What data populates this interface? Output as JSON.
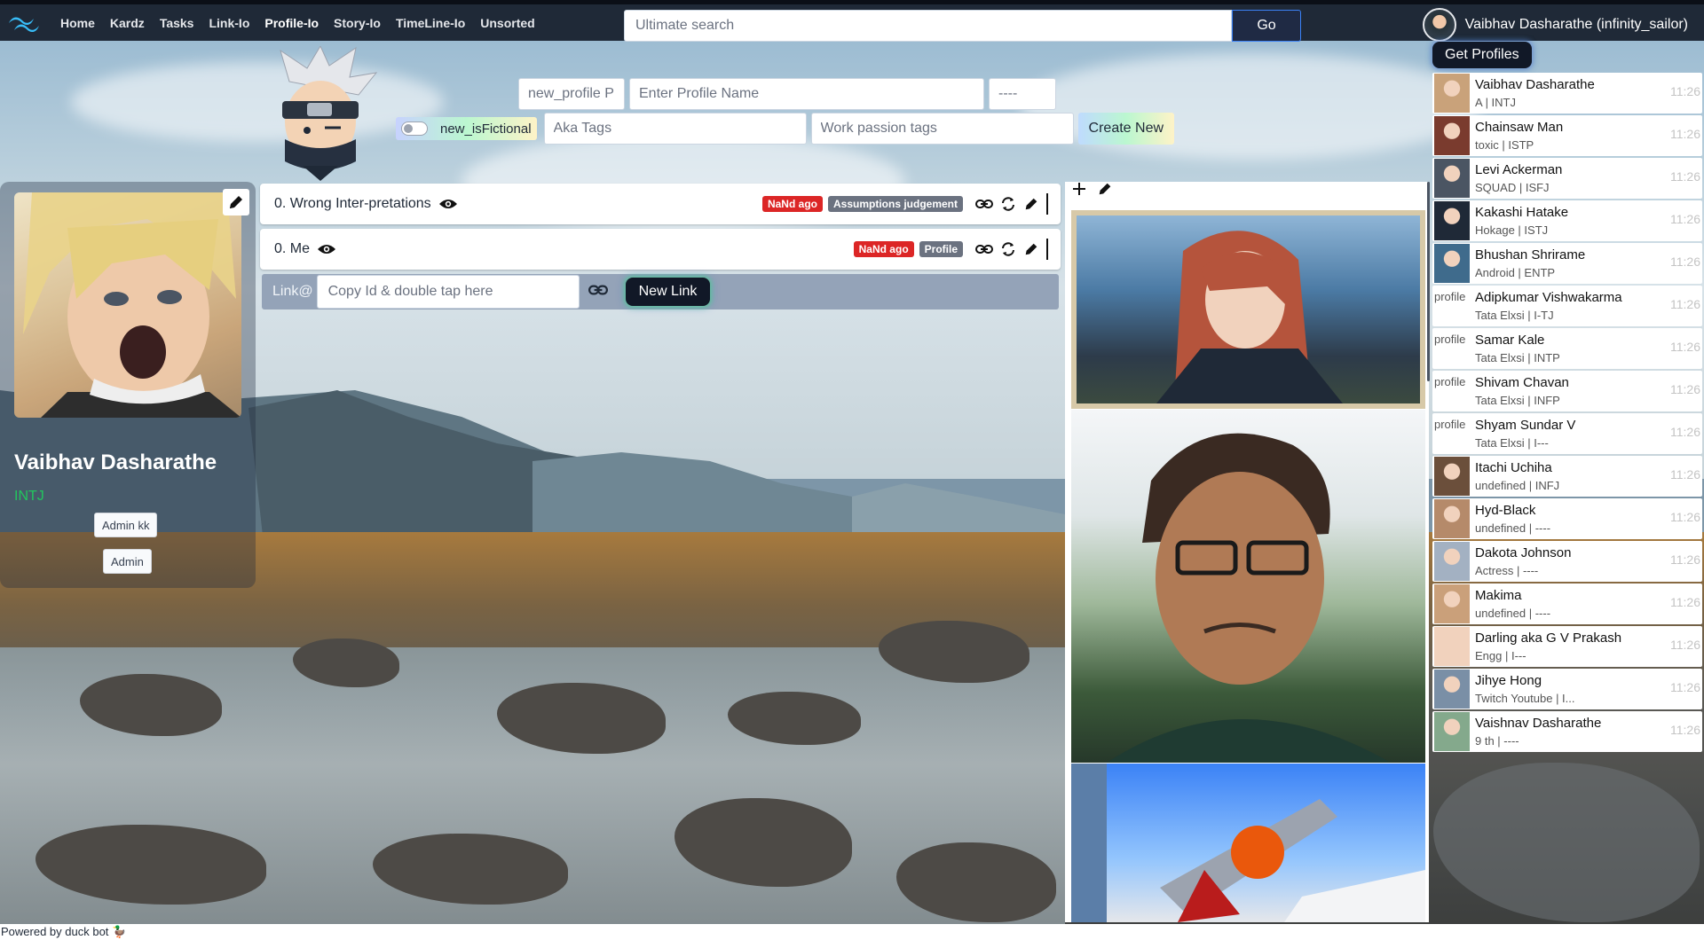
{
  "nav": {
    "items": [
      "Home",
      "Kardz",
      "Tasks",
      "Link-Io",
      "Profile-Io",
      "Story-Io",
      "TimeLine-Io",
      "Unsorted"
    ],
    "active": "Profile-Io",
    "search_placeholder": "Ultimate search",
    "go_label": "Go",
    "user_name": "Vaibhav Dasharathe (infinity_sailor)"
  },
  "create_form": {
    "new_profile_placeholder": "new_profile P",
    "profile_name_placeholder": "Enter Profile Name",
    "mbti_placeholder": "----",
    "fictional_label": "new_isFictional",
    "aka_placeholder": "Aka Tags",
    "work_placeholder": "Work passion tags",
    "create_label": "Create New"
  },
  "profile": {
    "name": "Vaibhav Dasharathe",
    "mbti": "INTJ",
    "buttons": [
      "Admin kk",
      "Admin"
    ]
  },
  "list": [
    {
      "title": "0. Wrong Inter-pretations",
      "time_tag": "NaNd ago",
      "category": "Assumptions judgement"
    },
    {
      "title": "0. Me",
      "time_tag": "NaNd ago",
      "category": "Profile"
    }
  ],
  "link_bar": {
    "label": "Link@",
    "placeholder": "Copy Id & double tap here",
    "button": "New Link"
  },
  "sidebar": {
    "button": "Get Profiles",
    "profiles": [
      {
        "name": "Vaibhav Dasharathe",
        "sub": "A | INTJ",
        "time": "11:26",
        "avatar": "photo"
      },
      {
        "name": "Chainsaw Man",
        "sub": "toxic | ISTP",
        "time": "11:26",
        "avatar": "photo"
      },
      {
        "name": "Levi Ackerman",
        "sub": "SQUAD | ISFJ",
        "time": "11:26",
        "avatar": "photo"
      },
      {
        "name": "Kakashi Hatake",
        "sub": "Hokage | ISTJ",
        "time": "11:26",
        "avatar": "photo"
      },
      {
        "name": "Bhushan Shrirame",
        "sub": "Android | ENTP",
        "time": "11:26",
        "avatar": "photo"
      },
      {
        "name": "Adipkumar Vishwakarma",
        "sub": "Tata Elxsi | I-TJ",
        "time": "11:26",
        "avatar": "broken",
        "alt": "profile"
      },
      {
        "name": "Samar Kale",
        "sub": "Tata Elxsi | INTP",
        "time": "11:26",
        "avatar": "broken",
        "alt": "profile"
      },
      {
        "name": "Shivam Chavan",
        "sub": "Tata Elxsi | INFP",
        "time": "11:26",
        "avatar": "broken",
        "alt": "profile"
      },
      {
        "name": "Shyam Sundar V",
        "sub": "Tata Elxsi | I---",
        "time": "11:26",
        "avatar": "broken",
        "alt": "profile"
      },
      {
        "name": "Itachi Uchiha",
        "sub": "undefined | INFJ",
        "time": "11:26",
        "avatar": "photo"
      },
      {
        "name": "Hyd-Black",
        "sub": "undefined | ----",
        "time": "11:26",
        "avatar": "photo"
      },
      {
        "name": "Dakota Johnson",
        "sub": "Actress | ----",
        "time": "11:26",
        "avatar": "photo"
      },
      {
        "name": "Makima",
        "sub": "undefined | ----",
        "time": "11:26",
        "avatar": "photo"
      },
      {
        "name": "Darling aka G V Prakash",
        "sub": "Engg | I---",
        "time": "11:26",
        "avatar": "photo"
      },
      {
        "name": "Jihye Hong",
        "sub": "Twitch Youtube | I...",
        "time": "11:26",
        "avatar": "photo"
      },
      {
        "name": "Vaishnav Dasharathe",
        "sub": "9 th | ----",
        "time": "11:26",
        "avatar": "photo"
      }
    ]
  },
  "footer": "Powered by duck bot 🦆",
  "colors": {
    "navbar": "#1f2937",
    "tag_red": "#dc2626",
    "tag_gray": "#6b7280",
    "mbti_green": "#22c55e"
  }
}
